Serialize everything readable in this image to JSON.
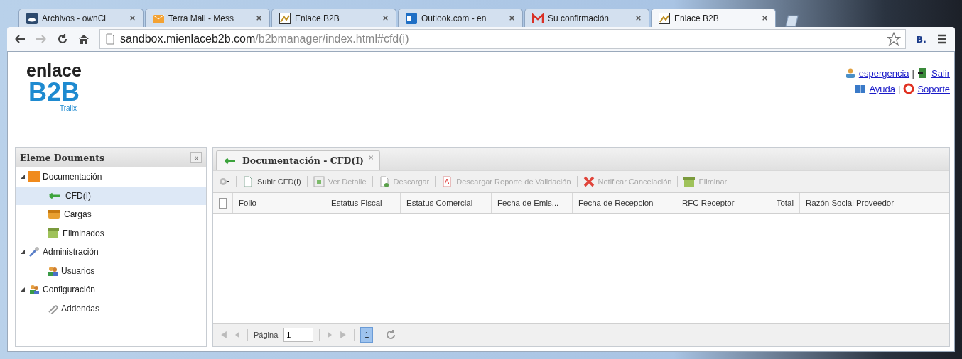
{
  "browser": {
    "tabs": [
      {
        "title": "Archivos - ownCl",
        "selected": false
      },
      {
        "title": "Terra Mail - Mess",
        "selected": false
      },
      {
        "title": "Enlace B2B",
        "selected": false
      },
      {
        "title": "Outlook.com - en",
        "selected": false
      },
      {
        "title": "Su confirmación",
        "selected": false
      },
      {
        "title": "Enlace B2B",
        "selected": true
      }
    ],
    "url_host": "sandbox.mienlaceb2b.com",
    "url_path": "/b2bmanager/index.html#cfd(i)",
    "extension": "B."
  },
  "header": {
    "logo": {
      "line1": "enlace",
      "line2": "B2B",
      "line3": "Tralix"
    },
    "links": [
      {
        "left": "espergencia",
        "separator": "|",
        "right": "Salir"
      },
      {
        "left": "Ayuda",
        "separator": "|",
        "right": "Soporte"
      }
    ]
  },
  "sidebar": {
    "title": "Eleme Douments",
    "collapse": "«",
    "items": [
      {
        "label": "Documentación",
        "expanded": true,
        "selected": false,
        "children": [
          {
            "label": "CFD(I)",
            "selected": true
          },
          {
            "label": "Cargas",
            "selected": false
          },
          {
            "label": "Eliminados",
            "selected": false
          }
        ]
      },
      {
        "label": "Administración",
        "expanded": true,
        "selected": false,
        "children": [
          {
            "label": "Usuarios",
            "selected": false
          }
        ]
      },
      {
        "label": "Configuración",
        "expanded": true,
        "selected": false,
        "children": [
          {
            "label": "Addendas",
            "selected": false
          }
        ]
      }
    ]
  },
  "panel": {
    "tab": {
      "title": "Documentación - CFD(I)",
      "close": "×"
    },
    "toolbar": [
      {
        "kind": "gear"
      },
      {
        "kind": "button",
        "label": "Subir CFD(I)",
        "disabled": false
      },
      {
        "kind": "button",
        "label": "Ver Detalle",
        "disabled": true
      },
      {
        "kind": "button",
        "label": "Descargar",
        "disabled": true
      },
      {
        "kind": "button",
        "label": "Descargar Reporte de Validación",
        "disabled": true
      },
      {
        "kind": "button",
        "label": "Notificar Cancelación",
        "disabled": true
      },
      {
        "kind": "button",
        "label": "Eliminar",
        "disabled": true
      }
    ],
    "table": {
      "select_all": {
        "checked": false
      },
      "columns": [
        "Folio",
        "Estatus Fiscal",
        "Estatus Comercial",
        "Fecha de Emis...",
        "Fecha de Recepcion",
        "RFC Receptor",
        "Total",
        "Razón Social Proveedor"
      ]
    },
    "pager": {
      "label": "Página",
      "value": "1",
      "page": "1"
    }
  }
}
